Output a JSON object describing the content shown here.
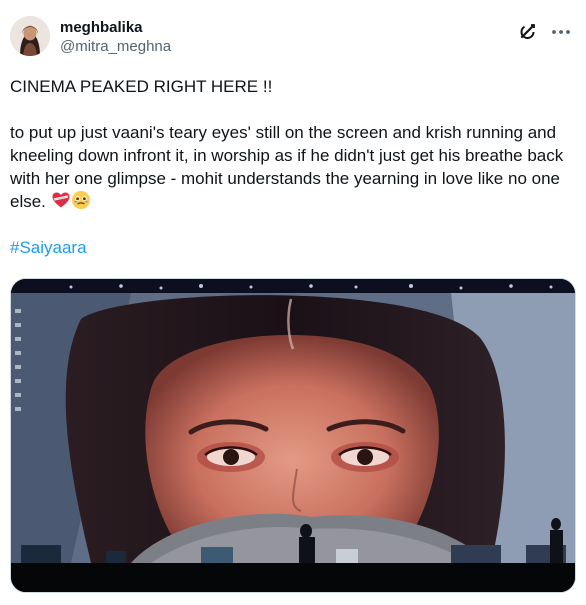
{
  "author": {
    "display_name": "meghbalika",
    "handle": "@mitra_meghna"
  },
  "icons": {
    "grok": "grok-icon",
    "more": "more-dots-icon",
    "heart_emoji": "mending-heart-emoji",
    "face_emoji": "holding-back-tears-emoji"
  },
  "tweet": {
    "title": "CINEMA PEAKED RIGHT HERE !!",
    "body": "to put up just vaani's teary eyes' still on the screen and krish running and kneeling down infront it, in worship as if he didn't just get his breathe back with her one glimpse - mohit understands the yearning in love like no one else.",
    "hashtag": "#Saiyaara"
  },
  "colors": {
    "text": "#0f1419",
    "secondary": "#536471",
    "link": "#1d9bf0",
    "border": "#cfd9de"
  }
}
